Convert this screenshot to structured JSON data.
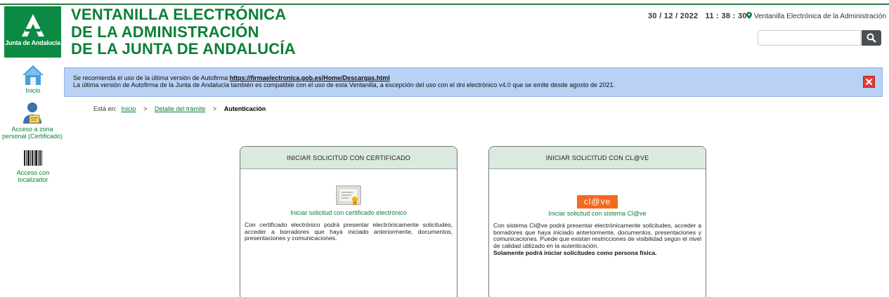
{
  "header": {
    "logo_text": "Junta de Andalucía",
    "title_lines": [
      "VENTANILLA ELECTRÓNICA",
      "DE LA ADMINISTRACIÓN",
      "DE LA JUNTA DE ANDALUCÍA"
    ],
    "datetime": "30 / 12 / 2022   11 : 38 : 30",
    "portal_link": "Ventanilla Electrónica de la Administración",
    "search": {
      "placeholder": "",
      "value": ""
    }
  },
  "sidebar": {
    "items": [
      {
        "label": "Inicio",
        "icon": "home-icon"
      },
      {
        "label": "Acceso a zona personal (Certificado)",
        "icon": "user-certificate-icon"
      },
      {
        "label": "Acceso con localizador",
        "icon": "barcode-icon"
      }
    ]
  },
  "alert": {
    "line1_prefix": "Se recomienda el uso de la última versión de Autofirma",
    "line1_link": "https://firmaelectronica.gob.es/Home/Descargas.html",
    "line2": "La última versión de Autofirma de la Junta de Andalucía también es compatible con el uso de esta Ventanilla, a excepción del uso con el dni electrónico v4.0 que se emite desde agosto de 2021."
  },
  "breadcrumb": {
    "prefix": "Está en:",
    "items": [
      "Inicio",
      "Detalle del trámite"
    ],
    "current": "Autenticación"
  },
  "cards": {
    "certificado": {
      "header": "INICIAR SOLICITUD CON CERTIFICADO",
      "link": "Iniciar solicitud con certificado electrónico",
      "text": "Con certificado electrónico podrá presentar electrónicamente solicitudes, acceder a borradores que haya iniciado anteriormente, documentos, presentaciones y comunicaciones."
    },
    "clave": {
      "header": "INICIAR SOLICITUD CON CL@VE",
      "logo_text": "cl@ve",
      "link": "Iniciar solicitud con sistema Cl@ve",
      "text": "Con sistema Cl@ve podrá presentar electrónicamente solicitudes, acceder a borradores que haya iniciado anteriormente, documentos, presentaciones y comunicaciones. Puede que existan restricciones de visibilidad según el nivel de calidad utilizado en la autenticación.",
      "note": "Solamente podrá iniciar solicitudes como persona física."
    }
  },
  "colors": {
    "brand_green": "#0b7f36",
    "alert_blue": "#b9d1f5",
    "card_header": "#dbe9de",
    "clave_orange": "#f26a21"
  }
}
